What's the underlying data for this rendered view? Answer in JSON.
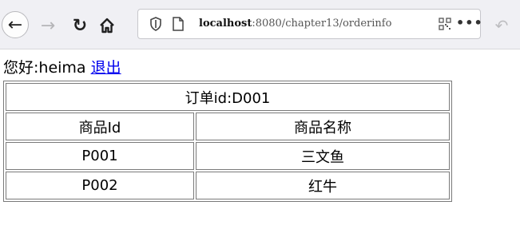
{
  "browser": {
    "url_host": "localhost",
    "url_path": ":8080/chapter13/orderinfo",
    "more_label": "•••"
  },
  "page": {
    "greeting": "您好:heima",
    "logout_label": "退出"
  },
  "order_table": {
    "title": "订单id:D001",
    "headers": [
      "商品Id",
      "商品名称"
    ],
    "rows": [
      [
        "P001",
        "三文鱼"
      ],
      [
        "P002",
        "红牛"
      ]
    ]
  }
}
